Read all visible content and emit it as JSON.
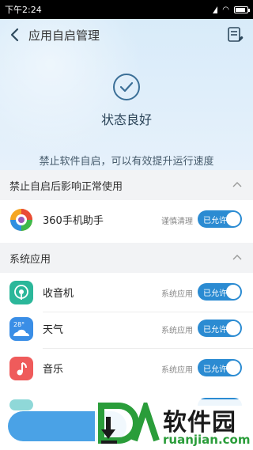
{
  "statusbar": {
    "time": "下午2:24"
  },
  "header": {
    "title": "应用自启管理",
    "back_icon": "back-chevron-icon",
    "menu_icon": "list-settings-icon"
  },
  "hero": {
    "status": "状态良好",
    "subtitle": "禁止软件自启，可以有效提升运行速度",
    "status_icon": "check-circle-icon"
  },
  "sections": [
    {
      "title": "禁止自启后影响正常使用",
      "apps": [
        {
          "name": "360手机助手",
          "status": "谨慎清理",
          "toggle": "已允许",
          "icon": "app-360-icon",
          "color": "#f5a623"
        }
      ]
    },
    {
      "title": "系统应用",
      "apps": [
        {
          "name": "收音机",
          "status": "系统应用",
          "toggle": "已允许",
          "icon": "radio-icon",
          "color": "#2bb79a"
        },
        {
          "name": "天气",
          "status": "系统应用",
          "toggle": "已允许",
          "icon": "weather-icon",
          "color": "#3a8ee6"
        },
        {
          "name": "音乐",
          "status": "系统应用",
          "toggle": "已允许",
          "icon": "music-icon",
          "color": "#ef5b5b"
        }
      ]
    }
  ],
  "watermark": {
    "brand": "软件园",
    "url": "ruanjian.com"
  },
  "colors": {
    "accent": "#2b8bd2",
    "hero_bg": "#dfeefa"
  }
}
